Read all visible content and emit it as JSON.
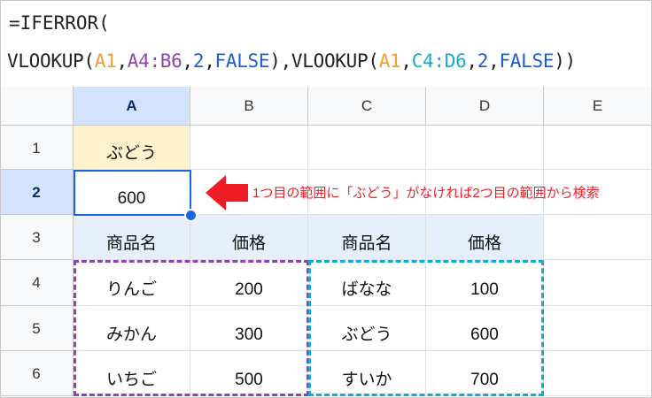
{
  "formula_bar": {
    "line1": "=IFERROR(",
    "line2_parts": [
      {
        "text": "VLOOKUP(",
        "color": "default"
      },
      {
        "text": "A1",
        "color": "orange"
      },
      {
        "text": ",",
        "color": "default"
      },
      {
        "text": "A4:B6",
        "color": "purple"
      },
      {
        "text": ",",
        "color": "default"
      },
      {
        "text": "2",
        "color": "blue"
      },
      {
        "text": ",",
        "color": "default"
      },
      {
        "text": "FALSE",
        "color": "blue"
      },
      {
        "text": "),VLOOKUP(",
        "color": "default"
      },
      {
        "text": "A1",
        "color": "orange"
      },
      {
        "text": ",",
        "color": "default"
      },
      {
        "text": "C4:D6",
        "color": "cyan"
      },
      {
        "text": ",",
        "color": "default"
      },
      {
        "text": "2",
        "color": "blue"
      },
      {
        "text": ",",
        "color": "default"
      },
      {
        "text": "FALSE",
        "color": "blue"
      },
      {
        "text": "))",
        "color": "default"
      }
    ]
  },
  "columns": [
    "A",
    "B",
    "C",
    "D",
    "E"
  ],
  "rows": [
    "1",
    "2",
    "3",
    "4",
    "5",
    "6"
  ],
  "selected_cell": "A2",
  "cells": [
    [
      "ぶどう",
      "",
      "",
      "",
      ""
    ],
    [
      "600",
      "",
      "",
      "",
      ""
    ],
    [
      "商品名",
      "価格",
      "商品名",
      "価格",
      ""
    ],
    [
      "りんご",
      "200",
      "ばなな",
      "100",
      ""
    ],
    [
      "みかん",
      "300",
      "ぶどう",
      "600",
      ""
    ],
    [
      "いちご",
      "500",
      "すいか",
      "700",
      ""
    ]
  ],
  "annotation": "1つ目の範囲に「ぶどう」がなければ2つ目の範囲から検索",
  "colors": {
    "range1": "#8e44ad",
    "range2": "#1aa8cc",
    "selection": "#1a66e0",
    "arrow": "#ee1c25",
    "lookup_value_fill": "#fff2cc",
    "header_fill": "#e6effb"
  }
}
